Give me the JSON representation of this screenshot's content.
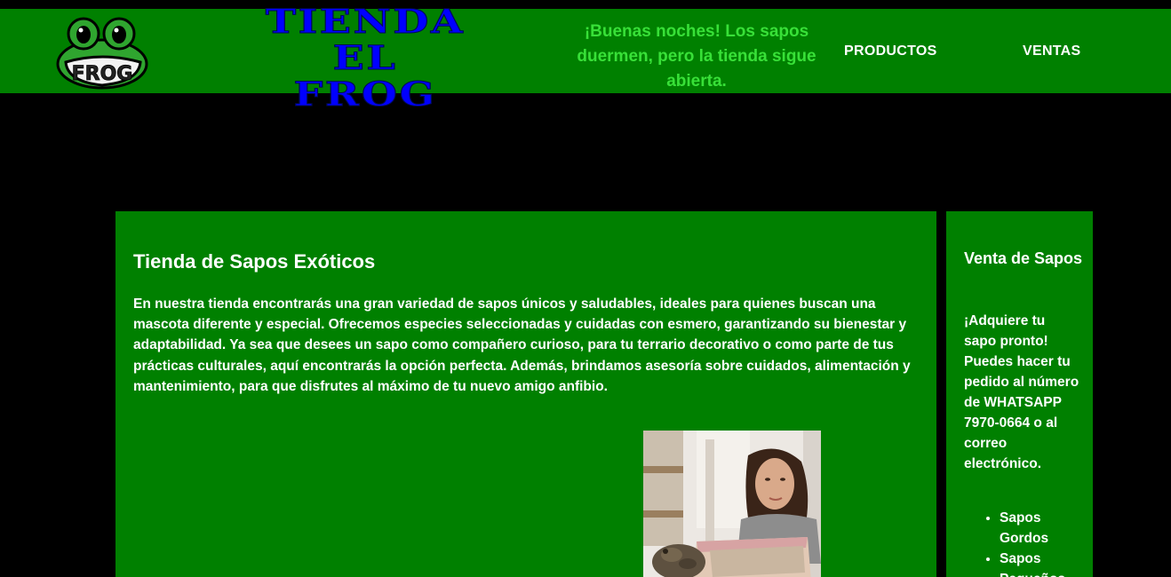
{
  "header": {
    "title_lines": [
      "TIENDA",
      "EL",
      "FROG"
    ],
    "logo_text": "FROG",
    "greeting": "¡Buenas noches! Los sapos duermen, pero la tienda sigue abierta.",
    "nav": {
      "productos": "PRODUCTOS",
      "ventas": "VENTAS"
    }
  },
  "main": {
    "heading": "Tienda de Sapos Exóticos",
    "paragraph": "En nuestra tienda encontrarás una gran variedad de sapos únicos y saludables, ideales para quienes buscan una mascota diferente y especial. Ofrecemos especies seleccionadas y cuidadas con esmero, garantizando su bienestar y adaptabilidad. Ya sea que desees un sapo como compañero curioso, para tu terrario decorativo o como parte de tus prácticas culturales, aquí encontrarás la opción perfecta. Además, brindamos asesoría sobre cuidados, alimentación y mantenimiento, para que disfrutes al máximo de tu nuevo amigo anfibio."
  },
  "aside": {
    "heading": "Venta de Sapos",
    "text": "¡Adquiere tu sapo pronto! Puedes hacer tu pedido al número de WHATSAPP 7970-0664 o al correo electrónico.",
    "items": [
      "Sapos Gordos",
      "Sapos Pequeños"
    ]
  },
  "colors": {
    "page_background": "#000000",
    "panel_green": "#008000",
    "title_blue": "#0000ff",
    "greeting_green": "#38e038",
    "text_white": "#ffffff"
  }
}
